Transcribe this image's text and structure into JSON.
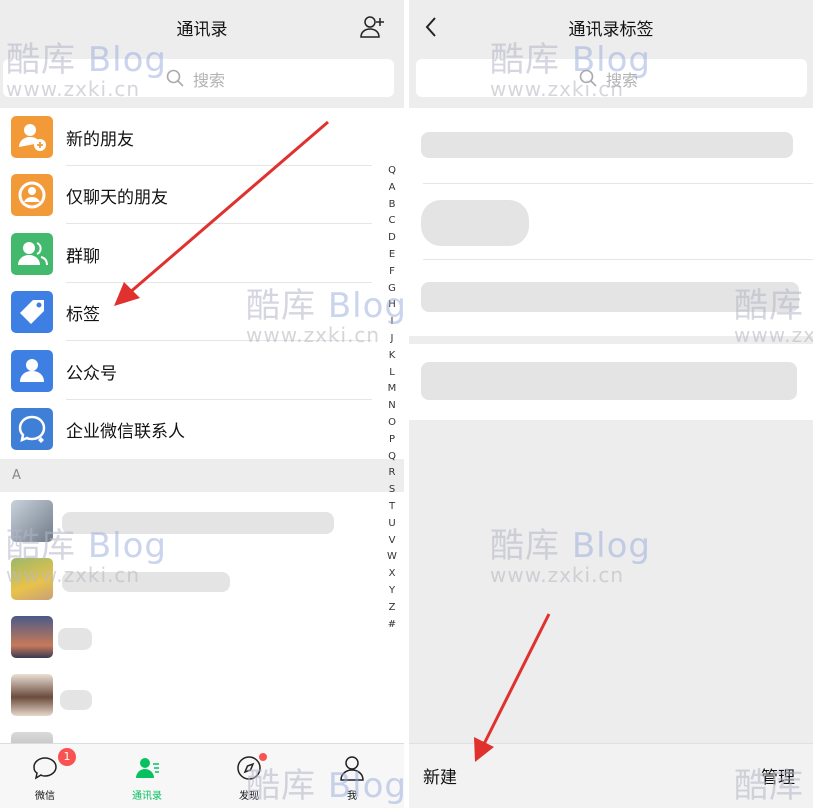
{
  "left": {
    "title": "通讯录",
    "search_placeholder": "搜索",
    "menu": [
      {
        "label": "新的朋友",
        "icon": "new-friend-icon",
        "color": "#f29a38"
      },
      {
        "label": "仅聊天的朋友",
        "icon": "chat-only-friend-icon",
        "color": "#f29a38"
      },
      {
        "label": "群聊",
        "icon": "group-chat-icon",
        "color": "#42b96c"
      },
      {
        "label": "标签",
        "icon": "tag-icon",
        "color": "#3e7fe3"
      },
      {
        "label": "公众号",
        "icon": "official-account-icon",
        "color": "#3e7fe3"
      },
      {
        "label": "企业微信联系人",
        "icon": "work-contact-icon",
        "color": "#3f7fd6"
      }
    ],
    "section_letter": "A",
    "index_letters": [
      "Q",
      "A",
      "B",
      "C",
      "D",
      "E",
      "F",
      "G",
      "H",
      "I",
      "J",
      "K",
      "L",
      "M",
      "N",
      "O",
      "P",
      "Q",
      "R",
      "S",
      "T",
      "U",
      "V",
      "W",
      "X",
      "Y",
      "Z",
      "#"
    ],
    "tabs": [
      {
        "label": "微信",
        "icon": "chat-bubble-icon",
        "badge": "1"
      },
      {
        "label": "通讯录",
        "icon": "contacts-icon",
        "active": true
      },
      {
        "label": "发现",
        "icon": "compass-icon"
      },
      {
        "label": "我",
        "icon": "person-icon"
      }
    ]
  },
  "right": {
    "title": "通讯录标签",
    "search_placeholder": "搜索",
    "new_label": "新建",
    "manage_label": "管理"
  },
  "watermark": {
    "brand_cn": "酷库",
    "brand_en": "Blog",
    "url": "www.zxki.cn"
  },
  "colors": {
    "accent_green": "#07c160",
    "arrow_red": "#e0312e",
    "badge_red": "#fa5151"
  }
}
